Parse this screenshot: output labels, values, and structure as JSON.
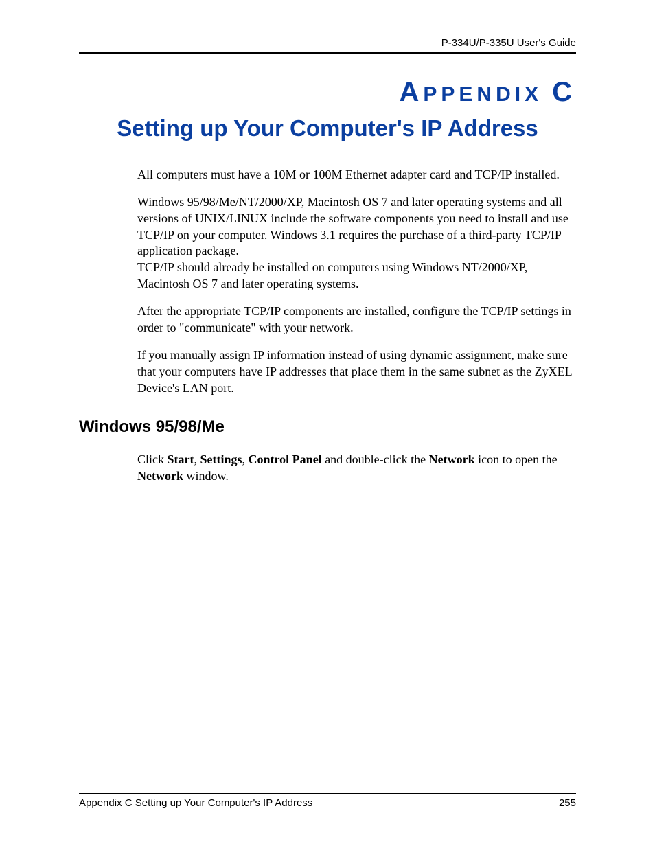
{
  "header": {
    "guide_name": "P-334U/P-335U User's Guide"
  },
  "appendix": {
    "label_a": "A",
    "label_ppendix": "PPENDIX",
    "label_letter": "C",
    "title": "Setting up Your Computer's IP Address"
  },
  "paragraphs": {
    "p1": "All computers must have a 10M or 100M Ethernet adapter card and TCP/IP installed.",
    "p2": "Windows 95/98/Me/NT/2000/XP, Macintosh OS 7 and later operating systems and all versions of UNIX/LINUX include the software components you need to install and use TCP/IP on your computer. Windows 3.1 requires the purchase of a third-party TCP/IP application package.",
    "p3": "TCP/IP should already be installed on computers using Windows NT/2000/XP, Macintosh OS 7 and later operating systems.",
    "p4": "After the appropriate TCP/IP components are installed, configure the TCP/IP settings in order to \"communicate\" with your network.",
    "p5": "If you manually assign IP information instead of using dynamic assignment, make sure that your computers have IP addresses that place them in the same subnet as the ZyXEL Device's LAN port."
  },
  "section": {
    "heading": "Windows 95/98/Me",
    "p6_pre": "Click ",
    "p6_b1": "Start",
    "p6_sep1": ", ",
    "p6_b2": "Settings",
    "p6_sep2": ", ",
    "p6_b3": "Control Panel",
    "p6_mid": " and double-click the ",
    "p6_b4": "Network",
    "p6_mid2": " icon to open the ",
    "p6_b5": "Network",
    "p6_end": " window."
  },
  "footer": {
    "left": "Appendix C Setting up Your Computer's IP Address",
    "page_number": "255"
  }
}
